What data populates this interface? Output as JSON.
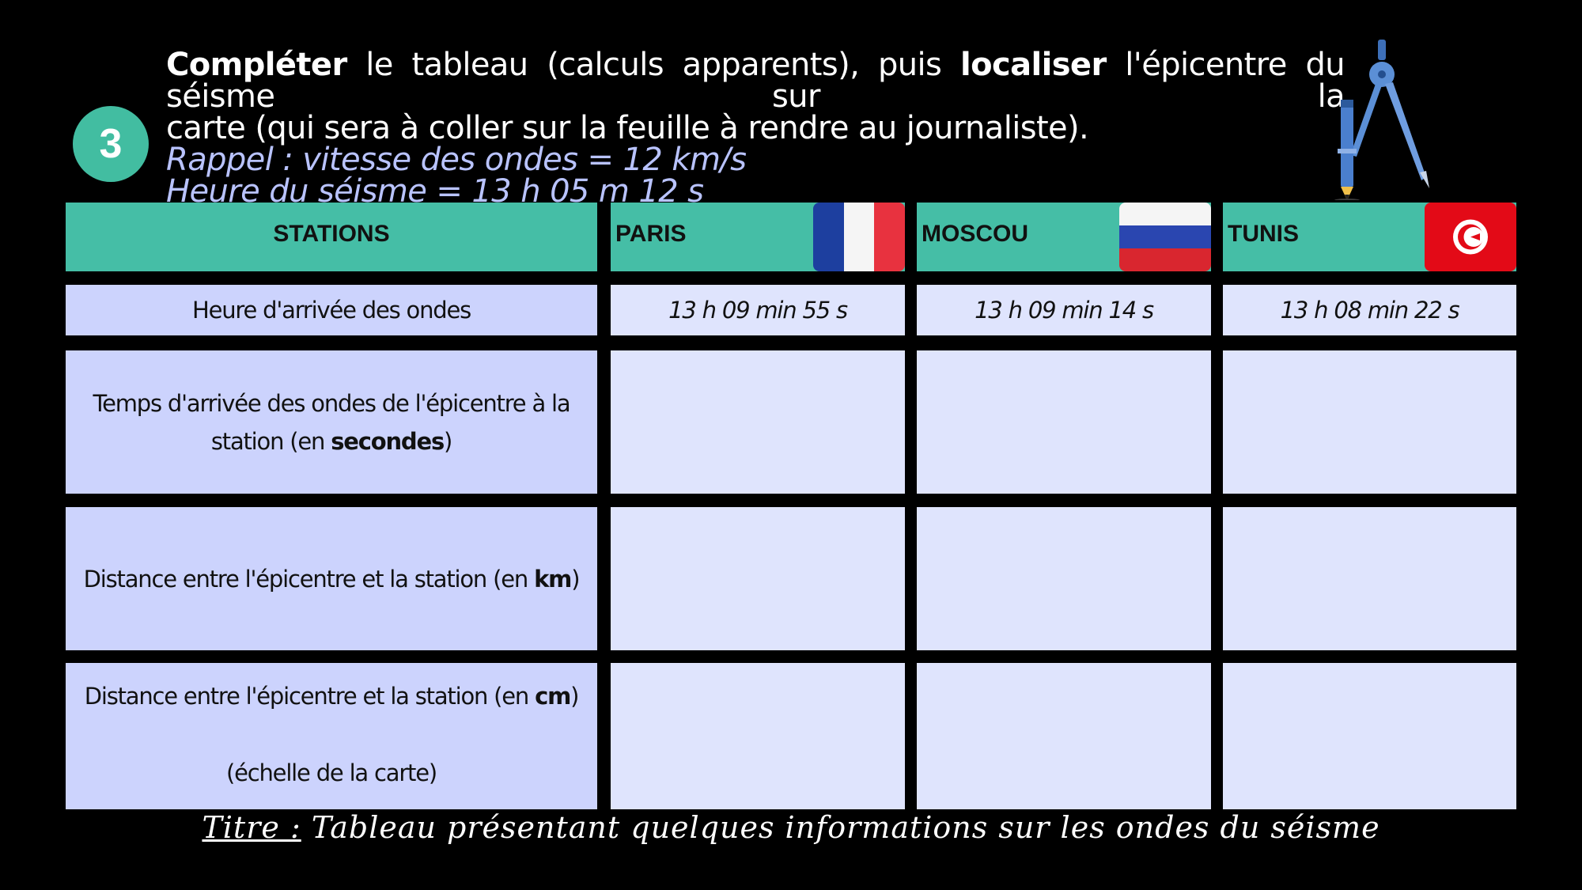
{
  "step_number": "3",
  "instructions": {
    "line1_bold_a": "Compléter",
    "line1_text_a": " le tableau (calculs apparents), puis ",
    "line1_bold_b": "localiser",
    "line1_text_b": " l'épicentre du séisme sur la",
    "line2": "carte (qui sera à coller sur la feuille à rendre au journaliste).",
    "reminder_speed": "Rappel : vitesse des ondes = 12 km/s",
    "reminder_time": "Heure du séisme = 13 h 05 m 12 s"
  },
  "table": {
    "header": {
      "stations": "STATIONS",
      "paris": "PARIS",
      "moscou": "MOSCOU",
      "tunis": "TUNIS"
    },
    "rows": {
      "arrival_label": "Heure d'arrivée des ondes",
      "arrival_paris": "13 h 09 min 55 s",
      "arrival_moscou": "13 h 09 min 14 s",
      "arrival_tunis": "13 h 08 min 22 s",
      "travel_label_a": "Temps d'arrivée des ondes de l'épicentre à la station (en ",
      "travel_label_bold": "secondes",
      "travel_label_b": ")",
      "dist_km_label_a": "Distance entre l'épicentre et la station (en ",
      "dist_km_label_bold": "km",
      "dist_km_label_b": ")",
      "dist_cm_label_a": "Distance entre l'épicentre et la station (en ",
      "dist_cm_label_bold": "cm",
      "dist_cm_label_b": ")",
      "dist_cm_label_c": "(échelle de la carte)"
    }
  },
  "caption": {
    "key": "Titre :",
    "text": " Tableau présentant quelques informations sur les ondes du séisme"
  },
  "colors": {
    "background": "#000000",
    "header_teal": "#45bea6",
    "badge_teal": "#42bda1",
    "label_cell": "#ccd3fd",
    "data_cell": "#dfe4fd",
    "reminder_text": "#b9c3ff"
  },
  "icons": {
    "compass": "drawing-compass-icon",
    "flag_paris": "france-flag",
    "flag_moscou": "russia-flag",
    "flag_tunis": "tunisia-flag"
  }
}
